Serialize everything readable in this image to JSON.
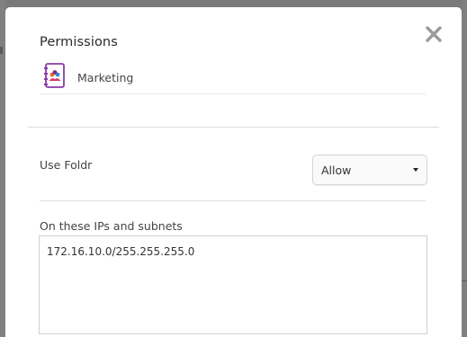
{
  "dialog": {
    "title": "Permissions",
    "close_icon": "close-icon"
  },
  "item": {
    "icon": "address-book-icon",
    "label": "Marketing"
  },
  "use_foldr": {
    "label": "Use Foldr",
    "select_value": "Allow"
  },
  "ips": {
    "label": "On these IPs and subnets",
    "value": "172.16.10.0/255.255.255.0"
  },
  "colors": {
    "accent": "#8a3aa8",
    "close": "#9a9a9a"
  }
}
